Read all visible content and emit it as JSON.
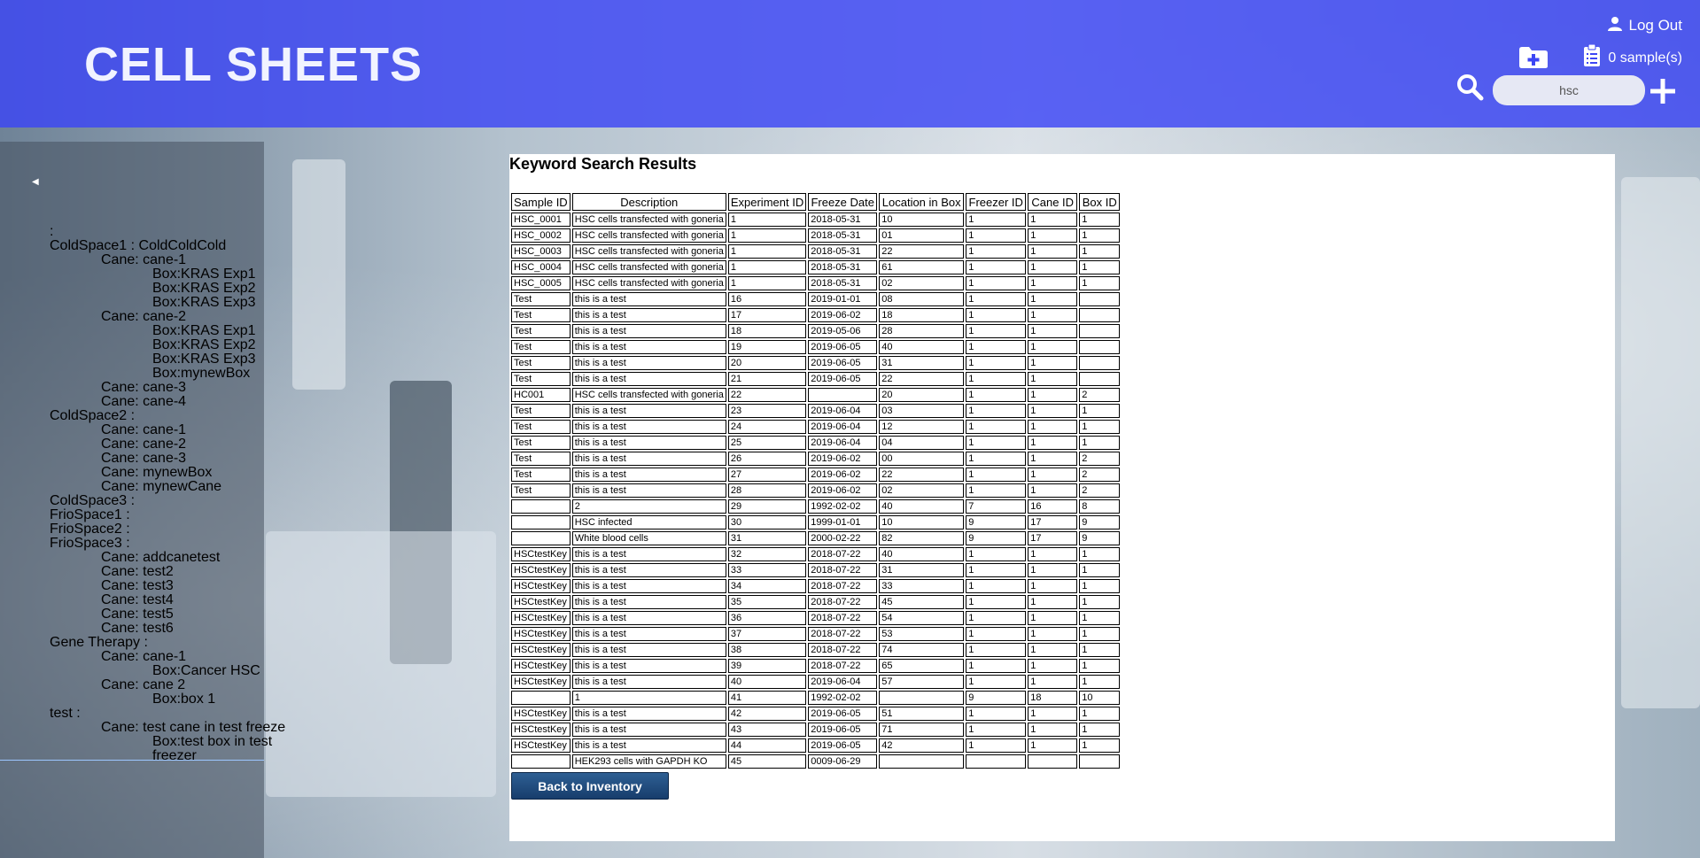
{
  "app": {
    "title": "CELL SHEETS"
  },
  "header": {
    "logout_label": "Log Out",
    "samples_label": "0 sample(s)",
    "search": {
      "value": "hsc"
    }
  },
  "sidebar": {
    "tree": [
      {
        "label": ":",
        "level": 0
      },
      {
        "label": "ColdSpace1 : ColdColdCold",
        "level": 0
      },
      {
        "label": "Cane: cane-1",
        "level": 1
      },
      {
        "label": "Box:KRAS Exp1",
        "level": 2
      },
      {
        "label": "Box:KRAS Exp2",
        "level": 2
      },
      {
        "label": "Box:KRAS Exp3",
        "level": 2
      },
      {
        "label": "Cane: cane-2",
        "level": 1
      },
      {
        "label": "Box:KRAS Exp1",
        "level": 2
      },
      {
        "label": "Box:KRAS Exp2",
        "level": 2
      },
      {
        "label": "Box:KRAS Exp3",
        "level": 2
      },
      {
        "label": "Box:mynewBox",
        "level": 2
      },
      {
        "label": "Cane: cane-3",
        "level": 1
      },
      {
        "label": "Cane: cane-4",
        "level": 1
      },
      {
        "label": "ColdSpace2 :",
        "level": 0
      },
      {
        "label": "Cane: cane-1",
        "level": 1
      },
      {
        "label": "Cane: cane-2",
        "level": 1
      },
      {
        "label": "Cane: cane-3",
        "level": 1
      },
      {
        "label": "Cane: mynewBox",
        "level": 1
      },
      {
        "label": "Cane: mynewCane",
        "level": 1
      },
      {
        "label": "ColdSpace3 :",
        "level": 0
      },
      {
        "label": "FrioSpace1 :",
        "level": 0
      },
      {
        "label": "FrioSpace2 :",
        "level": 0
      },
      {
        "label": "FrioSpace3 :",
        "level": 0
      },
      {
        "label": "Cane: addcanetest",
        "level": 1
      },
      {
        "label": "Cane: test2",
        "level": 1
      },
      {
        "label": "Cane: test3",
        "level": 1
      },
      {
        "label": "Cane: test4",
        "level": 1
      },
      {
        "label": "Cane: test5",
        "level": 1
      },
      {
        "label": "Cane: test6",
        "level": 1
      },
      {
        "label": "Gene Therapy :",
        "level": 0
      },
      {
        "label": "Cane: cane-1",
        "level": 1
      },
      {
        "label": "Box:Cancer HSC",
        "level": 2
      },
      {
        "label": "Cane: cane 2",
        "level": 1
      },
      {
        "label": "Box:box 1",
        "level": 2
      },
      {
        "label": "test :",
        "level": 0
      },
      {
        "label": "Cane: test cane in test freeze",
        "level": 1
      },
      {
        "label": "Box:test box in test",
        "level": 2
      },
      {
        "label": "freezer",
        "level": 2
      }
    ]
  },
  "results": {
    "title": "Keyword Search Results",
    "columns": [
      "Sample ID",
      "Description",
      "Experiment ID",
      "Freeze Date",
      "Location in Box",
      "Freezer ID",
      "Cane ID",
      "Box ID"
    ],
    "rows": [
      [
        "HSC_0001",
        "HSC cells transfected with goneria",
        "1",
        "2018-05-31",
        "10",
        "1",
        "1",
        "1"
      ],
      [
        "HSC_0002",
        "HSC cells transfected with goneria",
        "1",
        "2018-05-31",
        "01",
        "1",
        "1",
        "1"
      ],
      [
        "HSC_0003",
        "HSC cells transfected with goneria",
        "1",
        "2018-05-31",
        "22",
        "1",
        "1",
        "1"
      ],
      [
        "HSC_0004",
        "HSC cells transfected with goneria",
        "1",
        "2018-05-31",
        "61",
        "1",
        "1",
        "1"
      ],
      [
        "HSC_0005",
        "HSC cells transfected with goneria",
        "1",
        "2018-05-31",
        "02",
        "1",
        "1",
        "1"
      ],
      [
        "Test",
        "this is a test",
        "16",
        "2019-01-01",
        "08",
        "1",
        "1",
        ""
      ],
      [
        "Test",
        "this is a test",
        "17",
        "2019-06-02",
        "18",
        "1",
        "1",
        ""
      ],
      [
        "Test",
        "this is a test",
        "18",
        "2019-05-06",
        "28",
        "1",
        "1",
        ""
      ],
      [
        "Test",
        "this is a test",
        "19",
        "2019-06-05",
        "40",
        "1",
        "1",
        ""
      ],
      [
        "Test",
        "this is a test",
        "20",
        "2019-06-05",
        "31",
        "1",
        "1",
        ""
      ],
      [
        "Test",
        "this is a test",
        "21",
        "2019-06-05",
        "22",
        "1",
        "1",
        ""
      ],
      [
        "HC001",
        "HSC cells transfected with goneria",
        "22",
        "",
        "20",
        "1",
        "1",
        "2"
      ],
      [
        "Test",
        "this is a test",
        "23",
        "2019-06-04",
        "03",
        "1",
        "1",
        "1"
      ],
      [
        "Test",
        "this is a test",
        "24",
        "2019-06-04",
        "12",
        "1",
        "1",
        "1"
      ],
      [
        "Test",
        "this is a test",
        "25",
        "2019-06-04",
        "04",
        "1",
        "1",
        "1"
      ],
      [
        "Test",
        "this is a test",
        "26",
        "2019-06-02",
        "00",
        "1",
        "1",
        "2"
      ],
      [
        "Test",
        "this is a test",
        "27",
        "2019-06-02",
        "22",
        "1",
        "1",
        "2"
      ],
      [
        "Test",
        "this is a test",
        "28",
        "2019-06-02",
        "02",
        "1",
        "1",
        "2"
      ],
      [
        "",
        "2",
        "29",
        "1992-02-02",
        "40",
        "7",
        "16",
        "8"
      ],
      [
        "",
        "HSC infected",
        "30",
        "1999-01-01",
        "10",
        "9",
        "17",
        "9"
      ],
      [
        "",
        "White blood cells",
        "31",
        "2000-02-22",
        "82",
        "9",
        "17",
        "9"
      ],
      [
        "HSCtestKey",
        "this is a test",
        "32",
        "2018-07-22",
        "40",
        "1",
        "1",
        "1"
      ],
      [
        "HSCtestKey",
        "this is a test",
        "33",
        "2018-07-22",
        "31",
        "1",
        "1",
        "1"
      ],
      [
        "HSCtestKey",
        "this is a test",
        "34",
        "2018-07-22",
        "33",
        "1",
        "1",
        "1"
      ],
      [
        "HSCtestKey",
        "this is a test",
        "35",
        "2018-07-22",
        "45",
        "1",
        "1",
        "1"
      ],
      [
        "HSCtestKey",
        "this is a test",
        "36",
        "2018-07-22",
        "54",
        "1",
        "1",
        "1"
      ],
      [
        "HSCtestKey",
        "this is a test",
        "37",
        "2018-07-22",
        "53",
        "1",
        "1",
        "1"
      ],
      [
        "HSCtestKey",
        "this is a test",
        "38",
        "2018-07-22",
        "74",
        "1",
        "1",
        "1"
      ],
      [
        "HSCtestKey",
        "this is a test",
        "39",
        "2018-07-22",
        "65",
        "1",
        "1",
        "1"
      ],
      [
        "HSCtestKey",
        "this is a test",
        "40",
        "2019-06-04",
        "57",
        "1",
        "1",
        "1"
      ],
      [
        "",
        "1",
        "41",
        "1992-02-02",
        "",
        "9",
        "18",
        "10"
      ],
      [
        "HSCtestKey",
        "this is a test",
        "42",
        "2019-06-05",
        "51",
        "1",
        "1",
        "1"
      ],
      [
        "HSCtestKey",
        "this is a test",
        "43",
        "2019-06-05",
        "71",
        "1",
        "1",
        "1"
      ],
      [
        "HSCtestKey",
        "this is a test",
        "44",
        "2019-06-05",
        "42",
        "1",
        "1",
        "1"
      ],
      [
        "",
        "HEK293 cells with GAPDH KO",
        "45",
        "0009-06-29",
        "",
        "",
        "",
        ""
      ]
    ],
    "back_label": "Back to Inventory"
  },
  "icons": {
    "user": "user-icon",
    "clipboard": "clipboard-icon",
    "folder_add": "folder-add-icon",
    "search": "search-icon",
    "plus": "plus-icon",
    "collapse": "chevron-left-icon"
  },
  "colors": {
    "header": "#3c46f5",
    "button": "#1f4a7d"
  }
}
